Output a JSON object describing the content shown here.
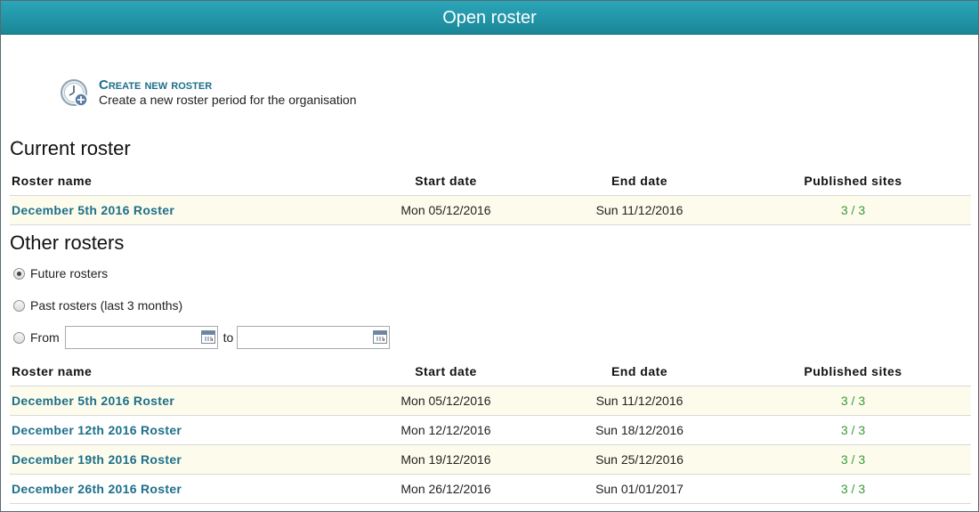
{
  "window": {
    "title": "Open roster"
  },
  "create": {
    "icon": "clock-add-icon",
    "link_label": "Create new roster",
    "description": "Create a new roster period for the organisation"
  },
  "current": {
    "title": "Current roster",
    "columns": [
      "Roster name",
      "Start date",
      "End date",
      "Published sites"
    ],
    "rows": [
      {
        "name": "December 5th 2016 Roster",
        "start": "Mon 05/12/2016",
        "end": "Sun 11/12/2016",
        "published": "3 / 3"
      }
    ]
  },
  "other": {
    "title": "Other rosters",
    "filters": {
      "future_label": "Future rosters",
      "past_label": "Past rosters (last 3 months)",
      "from_label": "From",
      "to_label": "to",
      "selected": "future",
      "from_value": "",
      "to_value": ""
    },
    "columns": [
      "Roster name",
      "Start date",
      "End date",
      "Published sites"
    ],
    "rows": [
      {
        "name": "December 5th 2016 Roster",
        "start": "Mon 05/12/2016",
        "end": "Sun 11/12/2016",
        "published": "3 / 3"
      },
      {
        "name": "December 12th 2016 Roster",
        "start": "Mon 12/12/2016",
        "end": "Sun 18/12/2016",
        "published": "3 / 3"
      },
      {
        "name": "December 19th 2016 Roster",
        "start": "Mon 19/12/2016",
        "end": "Sun 25/12/2016",
        "published": "3 / 3"
      },
      {
        "name": "December 26th 2016 Roster",
        "start": "Mon 26/12/2016",
        "end": "Sun 01/01/2017",
        "published": "3 / 3"
      }
    ]
  },
  "colors": {
    "titlebar": "#1f97a8",
    "link": "#1d6f8a",
    "published": "#3a9a3a",
    "row_highlight": "#fdfcec"
  }
}
